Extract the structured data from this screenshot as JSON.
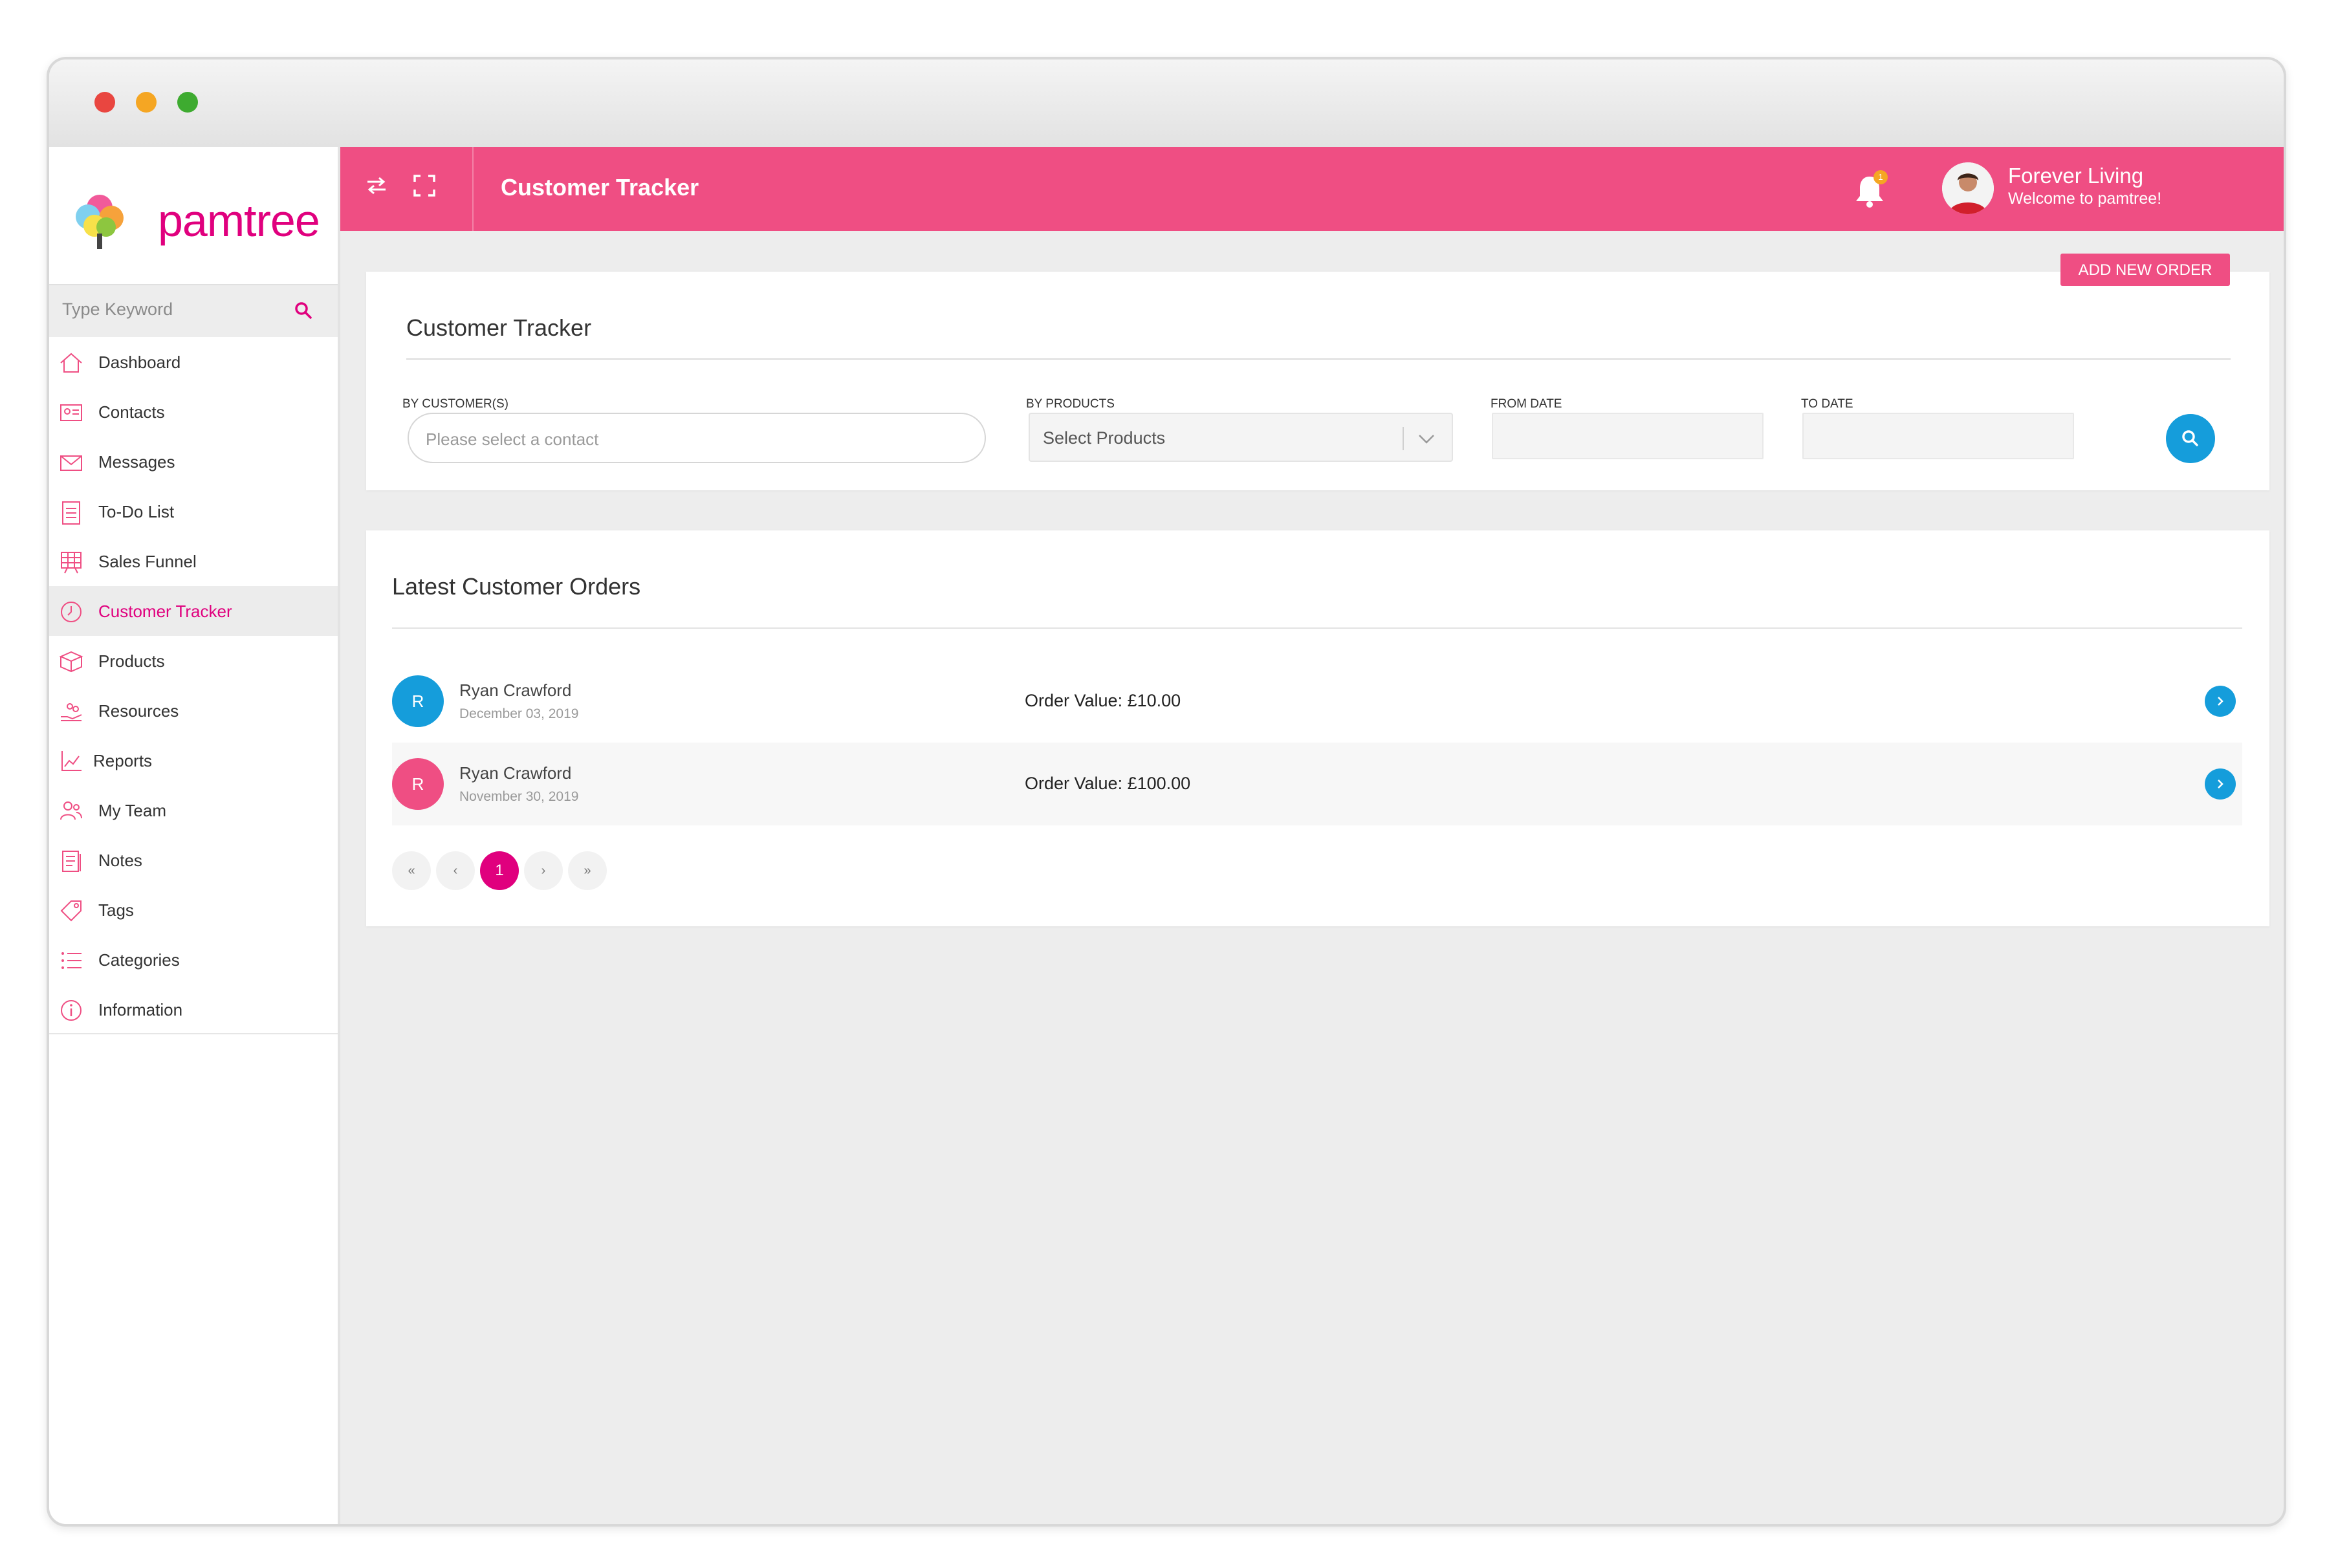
{
  "app": {
    "brand": "pamtree"
  },
  "sidebar": {
    "search_placeholder": "Type Keyword",
    "items": [
      {
        "label": "Dashboard",
        "icon": "home-icon"
      },
      {
        "label": "Contacts",
        "icon": "contact-card-icon"
      },
      {
        "label": "Messages",
        "icon": "envelope-icon"
      },
      {
        "label": "To-Do List",
        "icon": "clipboard-icon"
      },
      {
        "label": "Sales Funnel",
        "icon": "funnel-icon"
      },
      {
        "label": "Customer Tracker",
        "icon": "clock-icon",
        "active": true
      },
      {
        "label": "Products",
        "icon": "box-icon"
      },
      {
        "label": "Resources",
        "icon": "hand-icon"
      },
      {
        "label": "Reports",
        "icon": "chart-icon"
      },
      {
        "label": "My Team",
        "icon": "team-icon"
      },
      {
        "label": "Notes",
        "icon": "notes-icon"
      },
      {
        "label": "Tags",
        "icon": "tag-icon"
      },
      {
        "label": "Categories",
        "icon": "list-icon"
      },
      {
        "label": "Information",
        "icon": "info-icon"
      }
    ]
  },
  "header": {
    "title": "Customer Tracker",
    "notification_count": "1",
    "user_name": "Forever Living",
    "user_welcome": "Welcome to pamtree!"
  },
  "filter": {
    "add_button": "ADD NEW ORDER",
    "title": "Customer Tracker",
    "customer_label": "BY CUSTOMER(S)",
    "customer_placeholder": "Please select a contact",
    "products_label": "BY PRODUCTS",
    "products_placeholder": "Select Products",
    "from_label": "FROM DATE",
    "to_label": "TO DATE"
  },
  "orders": {
    "title": "Latest Customer Orders",
    "rows": [
      {
        "initial": "R",
        "name": "Ryan Crawford",
        "date": "December 03, 2019",
        "value": "Order Value: £10.00",
        "avatar_color": "#159ddb"
      },
      {
        "initial": "R",
        "name": "Ryan Crawford",
        "date": "November 30, 2019",
        "value": "Order Value: £100.00",
        "avatar_color": "#ef4e83"
      }
    ]
  },
  "pagination": {
    "first": "«",
    "prev": "‹",
    "current": "1",
    "next": "›",
    "last": "»"
  },
  "colors": {
    "accent_pink": "#ef4e83",
    "brand_magenta": "#e0007e",
    "action_blue": "#159ddb"
  }
}
